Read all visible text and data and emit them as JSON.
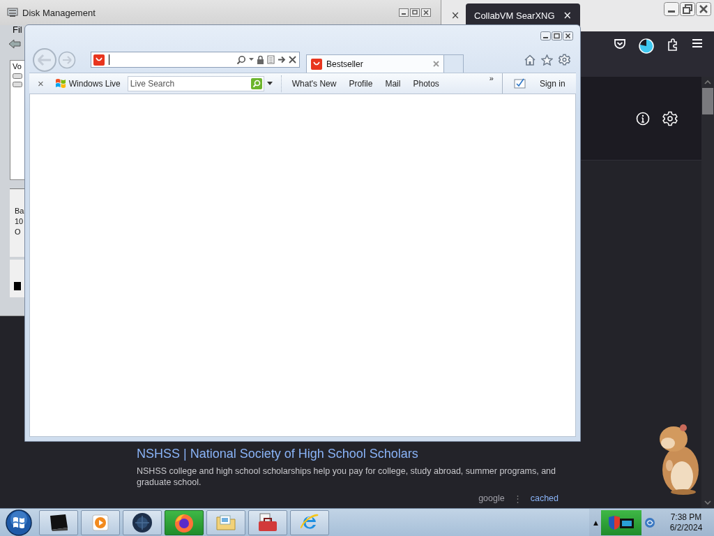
{
  "firefox": {
    "tabs": [
      {
        "close": "×",
        "selected": false
      },
      {
        "title": "CollabVM SearXNG",
        "close": "×",
        "selected": true
      }
    ],
    "search_result": {
      "title": "NSHSS | National Society of High School Scholars",
      "description": "NSHSS college and high school scholarships help you pay for college, study abroad, summer programs, and graduate school.",
      "source": "google",
      "separator": "⋮",
      "cached": "cached"
    }
  },
  "disk_management": {
    "title": "Disk Management",
    "menu": [
      "Fil"
    ],
    "column": "Vo",
    "disk_info": [
      "Ba",
      "10",
      "O"
    ]
  },
  "internet_explorer": {
    "tab": {
      "title": "Bestseller"
    },
    "toolbar": {
      "close": "×",
      "brand": "Windows Live",
      "search_placeholder": "Live Search",
      "links": [
        "What's New",
        "Profile",
        "Mail",
        "Photos"
      ],
      "more": "»",
      "sign_in": "Sign in"
    }
  },
  "taskbar": {
    "apps": [
      {
        "kind": "monitor",
        "highlighted": false
      },
      {
        "kind": "media",
        "highlighted": false
      },
      {
        "kind": "globe",
        "highlighted": false
      },
      {
        "kind": "firefox",
        "highlighted": true
      },
      {
        "kind": "explorer",
        "highlighted": false
      },
      {
        "kind": "toolbox",
        "highlighted": false
      },
      {
        "kind": "ie",
        "highlighted": false
      }
    ],
    "tray": {
      "expand": "▲"
    },
    "clock": {
      "time": "7:38 PM",
      "date": "6/2/2024"
    }
  }
}
